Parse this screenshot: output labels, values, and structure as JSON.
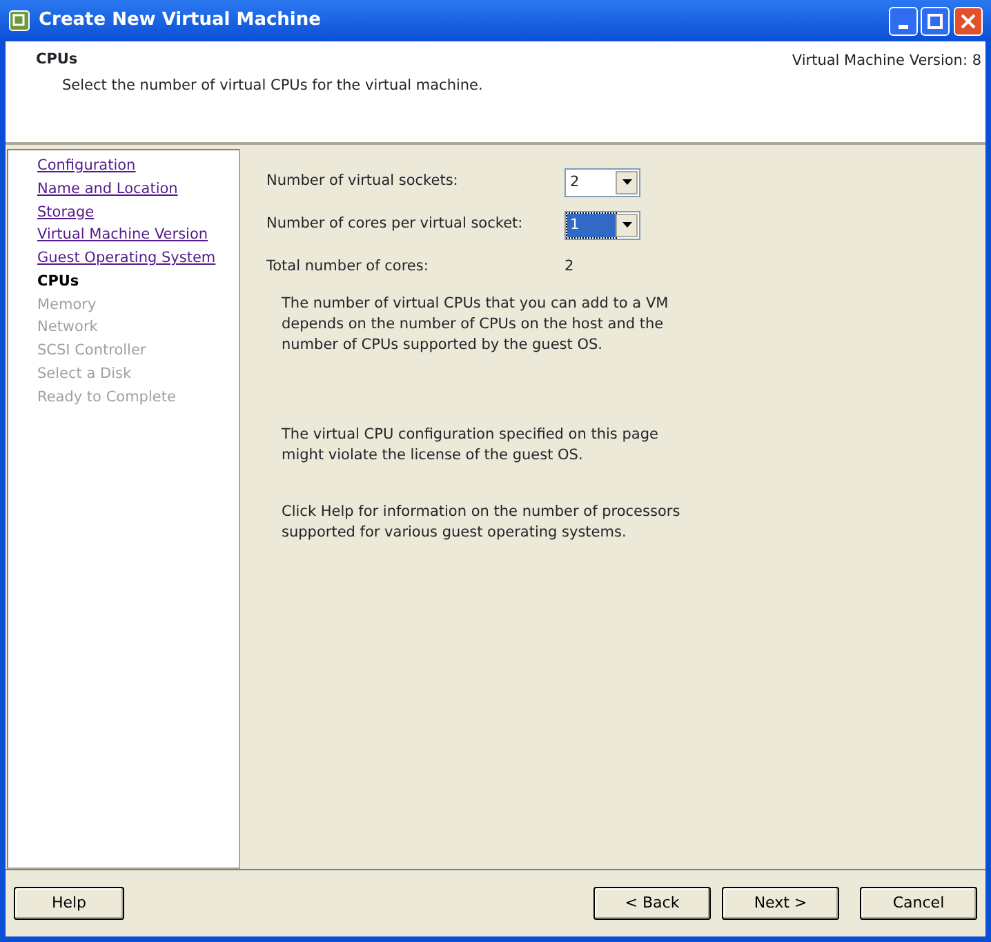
{
  "window": {
    "title": "Create New Virtual Machine"
  },
  "header": {
    "title": "CPUs",
    "subtitle": "Select the number of virtual CPUs for the virtual machine.",
    "version": "Virtual Machine Version: 8"
  },
  "steps": [
    {
      "label": "Configuration",
      "kind": "done"
    },
    {
      "label": "Name and Location",
      "kind": "done"
    },
    {
      "label": "Storage",
      "kind": "done"
    },
    {
      "label": "Virtual Machine Version",
      "kind": "done"
    },
    {
      "label": "Guest Operating System",
      "kind": "done"
    },
    {
      "label": "CPUs",
      "kind": "current"
    },
    {
      "label": "Memory",
      "kind": "pending"
    },
    {
      "label": "Network",
      "kind": "pending"
    },
    {
      "label": "SCSI Controller",
      "kind": "pending"
    },
    {
      "label": "Select a Disk",
      "kind": "pending"
    },
    {
      "label": "Ready to Complete",
      "kind": "pending"
    }
  ],
  "fields": [
    {
      "label": "Number of virtual sockets:",
      "value": "2",
      "kind": "dropdown",
      "focused": false
    },
    {
      "label": "Number of cores per virtual socket:",
      "value": "1",
      "kind": "dropdown",
      "focused": true
    },
    {
      "label": "Total number of cores:",
      "value": "2",
      "kind": "readout"
    }
  ],
  "notes": [
    "The number of virtual CPUs that you can add to a VM depends on the number of CPUs on the host and the number of CPUs supported by the guest OS.",
    "The virtual CPU configuration specified on this page might violate the license of the guest OS.",
    "Click Help for information on the number of processors supported for various guest operating systems."
  ],
  "buttons": {
    "left": [
      "Help"
    ],
    "right": [
      "< Back",
      "Next >",
      "Cancel"
    ]
  }
}
